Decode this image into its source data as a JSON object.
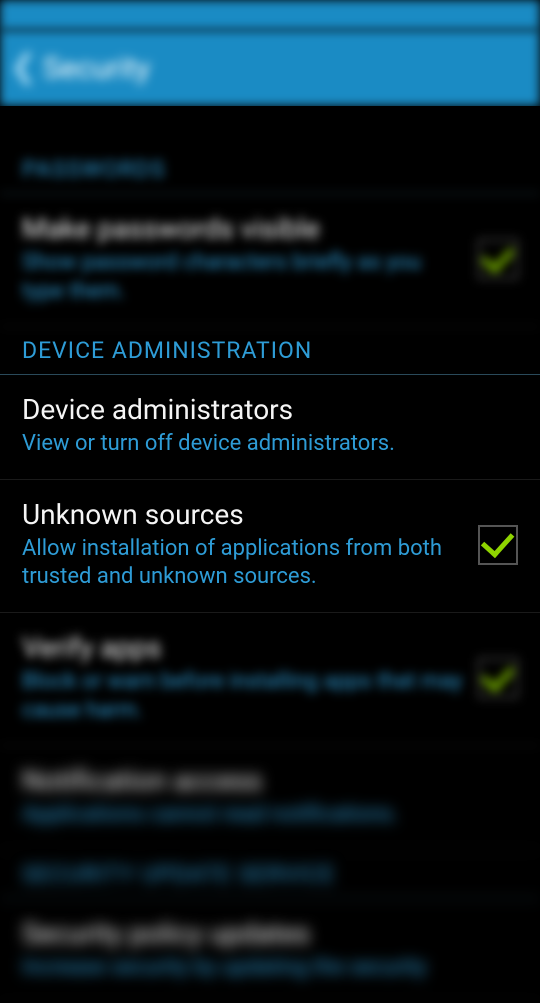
{
  "nav": {
    "title": "Security"
  },
  "sections": {
    "passwords": {
      "header": "PASSWORDS",
      "make_passwords_visible": {
        "title": "Make passwords visible",
        "desc": "Show password characters briefly as you type them."
      }
    },
    "device_admin": {
      "header": "DEVICE ADMINISTRATION",
      "device_administrators": {
        "title": "Device administrators",
        "desc": "View or turn off device administrators."
      },
      "unknown_sources": {
        "title": "Unknown sources",
        "desc": "Allow installation of applications from both trusted and unknown sources."
      },
      "verify_apps": {
        "title": "Verify apps",
        "desc": "Block or warn before installing apps that may cause harm."
      },
      "notification_access": {
        "title": "Notification access",
        "desc": "Applications cannot read notifications."
      }
    },
    "security_update": {
      "header": "SECURITY UPDATE SERVICE",
      "security_policy": {
        "title": "Security policy updates",
        "desc": "Increase security by updating the security"
      }
    }
  }
}
